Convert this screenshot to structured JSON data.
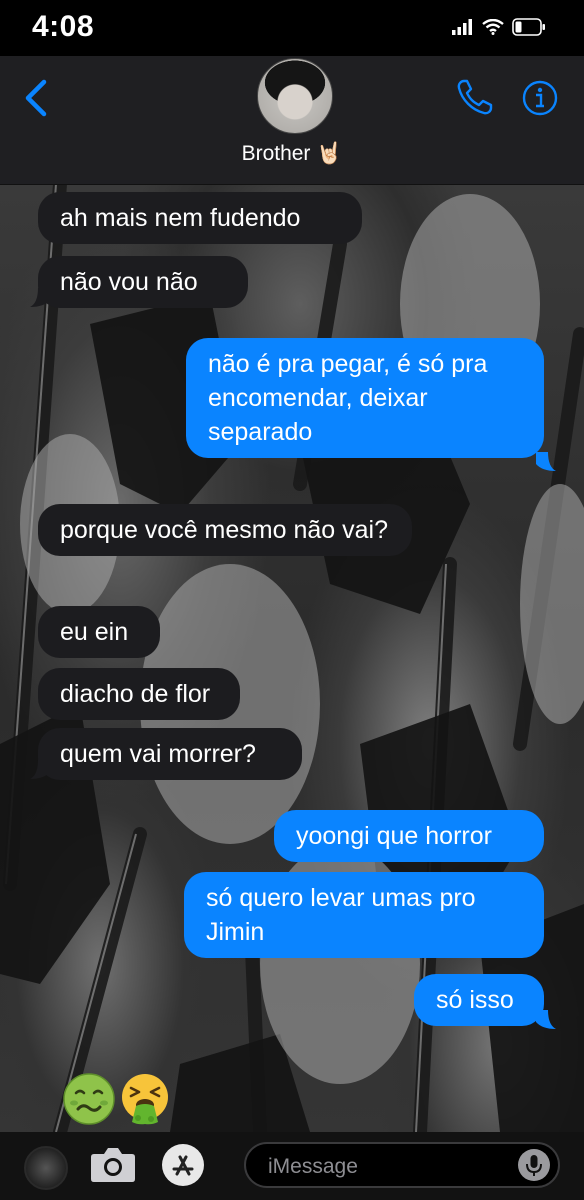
{
  "status_bar": {
    "time": "4:08",
    "icons": [
      "cellular-signal-icon",
      "wifi-icon",
      "battery-icon"
    ]
  },
  "header": {
    "contact_name": "Brother 🤘🏻",
    "icons": [
      "back-chevron-icon",
      "phone-icon",
      "info-icon"
    ],
    "accent_color": "#0a84ff"
  },
  "messages": [
    {
      "direction": "incoming",
      "text": "ah mais nem fudendo"
    },
    {
      "direction": "incoming",
      "text": "não vou não"
    },
    {
      "direction": "outgoing",
      "text": "não é pra pegar, é só pra encomendar, deixar separado"
    },
    {
      "direction": "incoming",
      "text": "porque você mesmo não vai?"
    },
    {
      "direction": "incoming",
      "text": "eu ein"
    },
    {
      "direction": "incoming",
      "text": "diacho de flor"
    },
    {
      "direction": "incoming",
      "text": "quem vai morrer?"
    },
    {
      "direction": "outgoing",
      "text": "yoongi que horror"
    },
    {
      "direction": "outgoing",
      "text": "só quero levar umas pro Jimin"
    },
    {
      "direction": "outgoing",
      "text": "só isso"
    }
  ],
  "reactions": [
    "nauseated-face-emoji",
    "vomiting-face-emoji"
  ],
  "composer": {
    "placeholder": "iMessage",
    "icons": [
      "app-drawer-icon",
      "camera-icon",
      "app-store-icon",
      "microphone-icon"
    ]
  },
  "colors": {
    "incoming_bubble": "#1c1c1f",
    "outgoing_bubble": "#0a84ff",
    "header_bg": "#1f1f22"
  }
}
